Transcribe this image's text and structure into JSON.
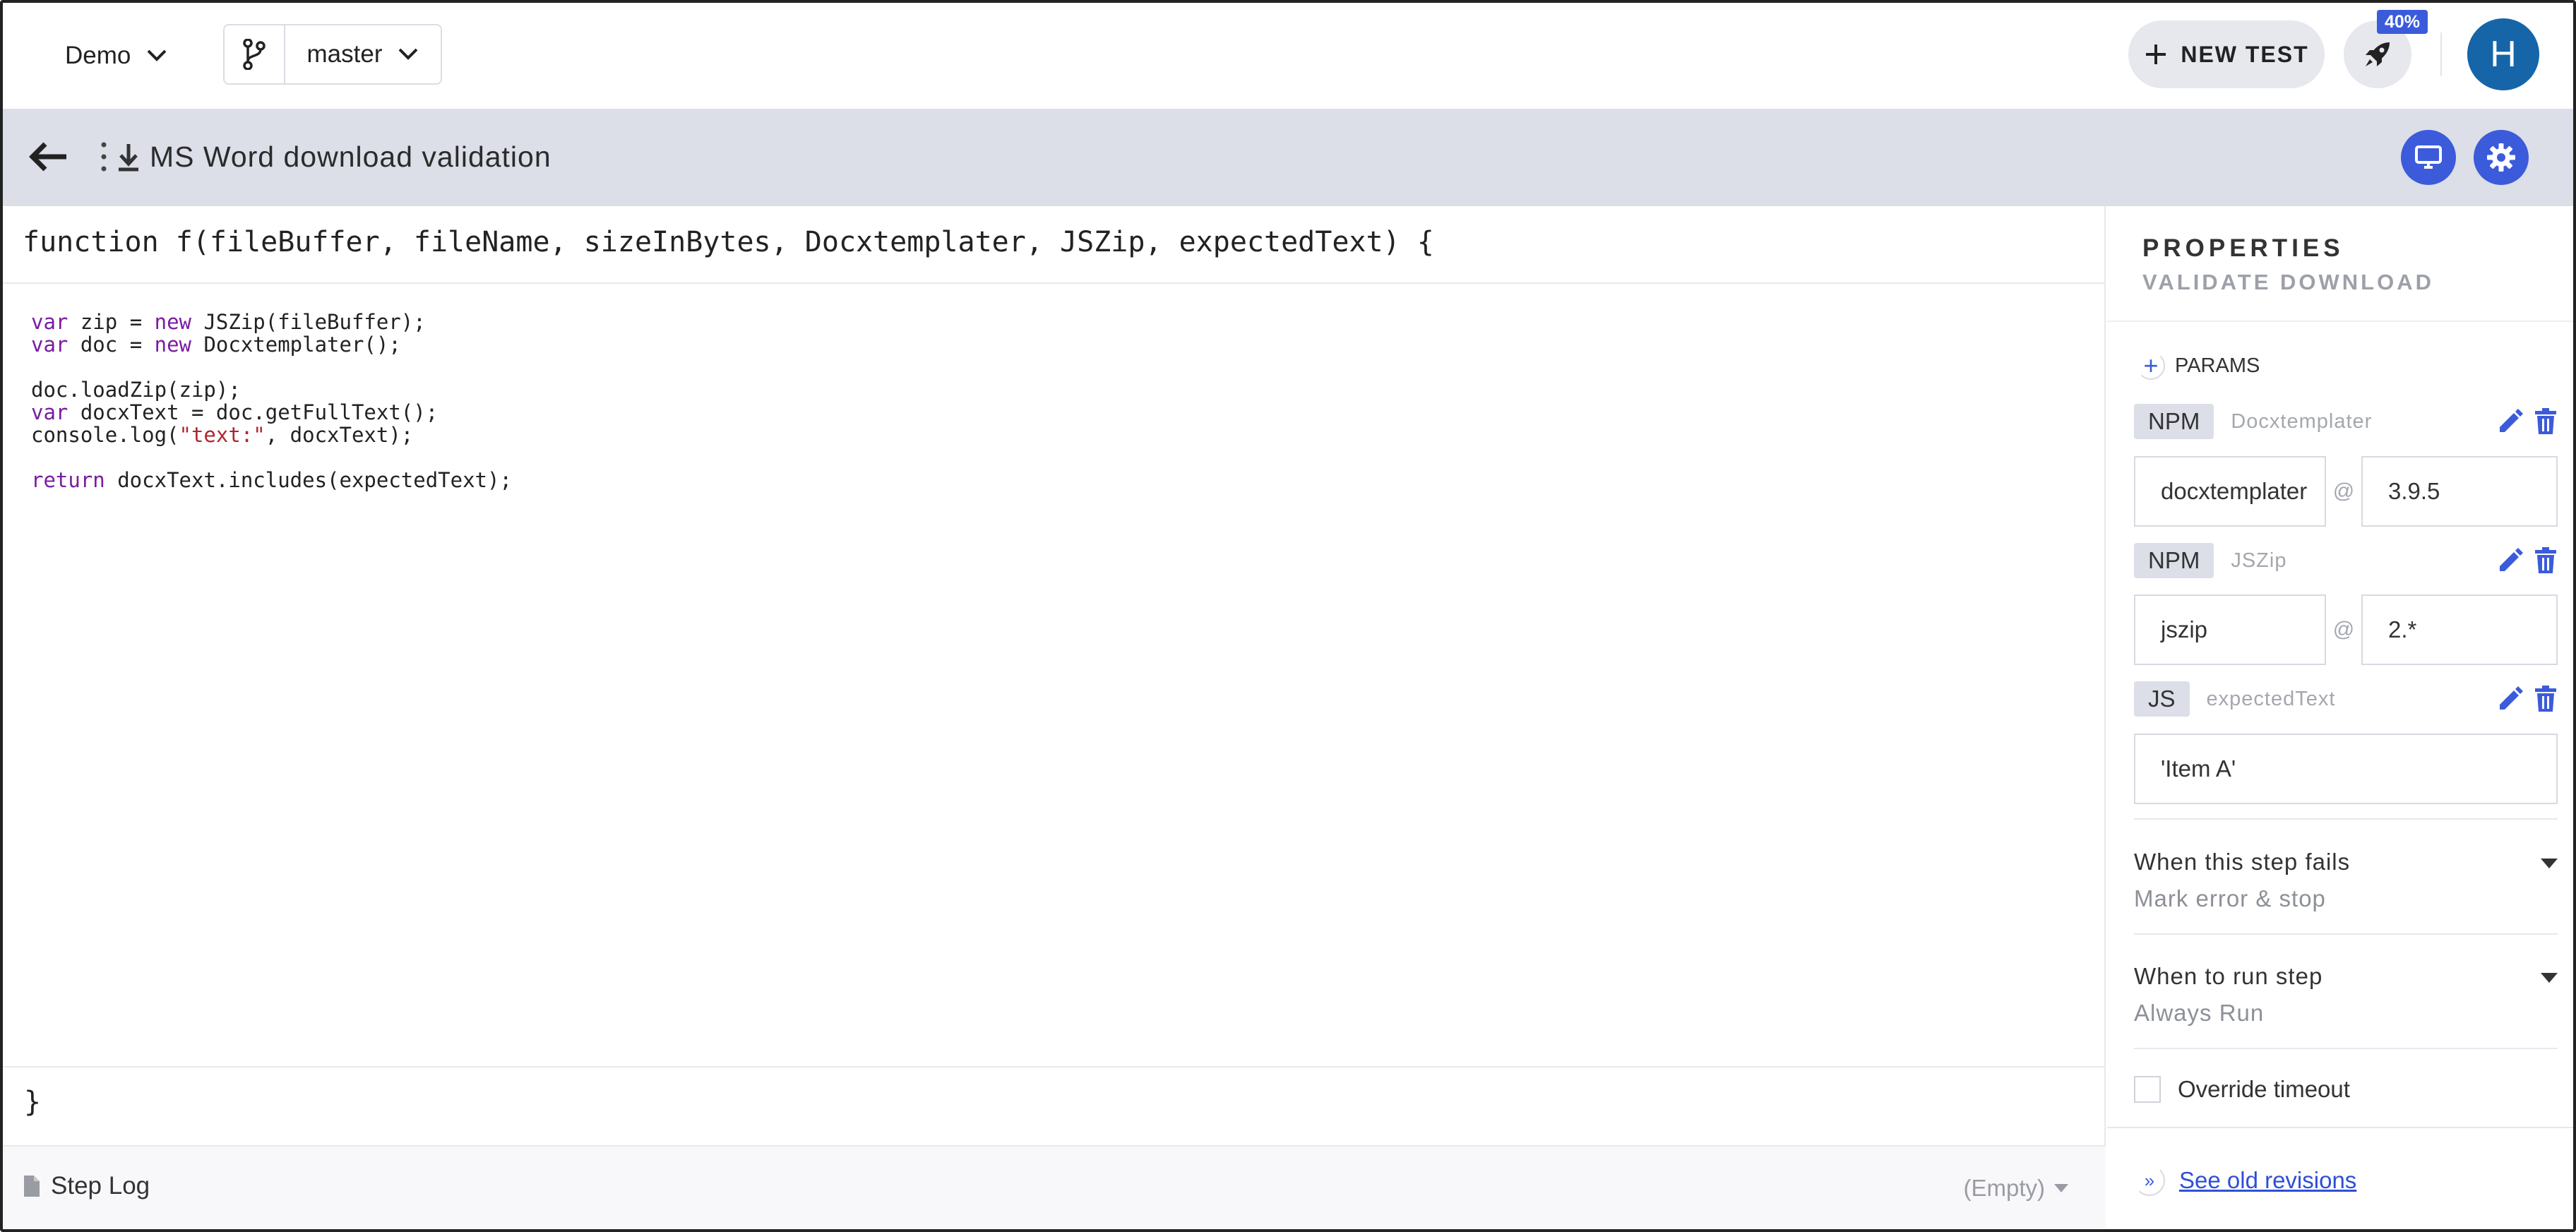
{
  "topbar": {
    "project": "Demo",
    "branch": "master",
    "new_test_label": "NEW TEST",
    "rocket_badge": "40%",
    "avatar_initial": "H"
  },
  "step": {
    "title": "MS Word download validation"
  },
  "code": {
    "signature": "function f(fileBuffer, fileName, sizeInBytes, Docxtemplater, JSZip, expectedText) {",
    "lines": [
      [
        {
          "t": "var",
          "c": "kw"
        },
        {
          "t": " zip = "
        },
        {
          "t": "new",
          "c": "kw"
        },
        {
          "t": " JSZip(fileBuffer);"
        }
      ],
      [
        {
          "t": "var",
          "c": "kw"
        },
        {
          "t": " doc = "
        },
        {
          "t": "new",
          "c": "kw"
        },
        {
          "t": " Docxtemplater();"
        }
      ],
      [],
      [
        {
          "t": "doc.loadZip(zip);"
        }
      ],
      [
        {
          "t": "var",
          "c": "kw"
        },
        {
          "t": " docxText = doc.getFullText();"
        }
      ],
      [
        {
          "t": "console.log("
        },
        {
          "t": "\"text:\"",
          "c": "str"
        },
        {
          "t": ", docxText);"
        }
      ],
      [],
      [
        {
          "t": "return",
          "c": "kw"
        },
        {
          "t": " docxText.includes(expectedText);"
        }
      ]
    ],
    "closing": "}"
  },
  "steplog": {
    "label": "Step Log",
    "status": "(Empty)"
  },
  "properties": {
    "title": "PROPERTIES",
    "subtitle": "VALIDATE DOWNLOAD",
    "params_label": "PARAMS",
    "params": [
      {
        "type": "NPM",
        "name": "Docxtemplater",
        "package": "docxtemplater",
        "version": "3.9.5"
      },
      {
        "type": "NPM",
        "name": "JSZip",
        "package": "jszip",
        "version": "2.*"
      },
      {
        "type": "JS",
        "name": "expectedText",
        "value": "'Item A'"
      }
    ],
    "on_fail": {
      "label": "When this step fails",
      "value": "Mark error & stop"
    },
    "when_run": {
      "label": "When to run step",
      "value": "Always Run"
    },
    "override_timeout": "Override timeout",
    "see_revisions": "See old revisions"
  },
  "colors": {
    "accent": "#3b5bdb",
    "avatar": "#1565a8",
    "header_bar": "#dcdee8",
    "keyword": "#7a1ca0",
    "string": "#b0252e"
  }
}
